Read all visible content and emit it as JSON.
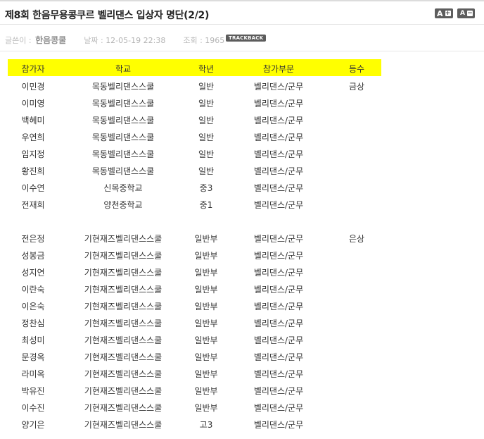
{
  "post": {
    "title": "제8회 한음무용콩쿠르 벨리댄스 입상자 명단(2/2)",
    "font_controls": {
      "increase_label": "A",
      "increase_sign": "+",
      "decrease_label": "A",
      "decrease_sign": "−"
    },
    "meta": {
      "author_label": "글쓴이 :",
      "author": "한음콩쿨",
      "date_label": "날짜 :",
      "date": "12-05-19 22:38",
      "views_label": "조회 :",
      "views": "1965",
      "trackback_label": "TRACKBACK"
    }
  },
  "table": {
    "headers": [
      "참가자",
      "학교",
      "학년",
      "참가부문",
      "등수"
    ],
    "group1": [
      [
        "이민경",
        "목동벨리댄스스쿨",
        "일반",
        "벨리댄스/군무",
        "금상"
      ],
      [
        "이미영",
        "목동벨리댄스스쿨",
        "일반",
        "벨리댄스/군무",
        ""
      ],
      [
        "백혜미",
        "목동벨리댄스스쿨",
        "일반",
        "벨리댄스/군무",
        ""
      ],
      [
        "우연희",
        "목동벨리댄스스쿨",
        "일반",
        "벨리댄스/군무",
        ""
      ],
      [
        "임지정",
        "목동벨리댄스스쿨",
        "일반",
        "벨리댄스/군무",
        ""
      ],
      [
        "황진희",
        "목동벨리댄스스쿨",
        "일반",
        "벨리댄스/군무",
        ""
      ],
      [
        "이수연",
        "신목중학교",
        "중3",
        "벨리댄스/군무",
        ""
      ],
      [
        "전재희",
        "양천중학교",
        "중1",
        "벨리댄스/군무",
        ""
      ]
    ],
    "group2": [
      [
        "전은정",
        "기현재즈벨리댄스스쿨",
        "일반부",
        "벨리댄스/군무",
        "은상"
      ],
      [
        "성봉금",
        "기현재즈벨리댄스스쿨",
        "일반부",
        "벨리댄스/군무",
        ""
      ],
      [
        "성지연",
        "기현재즈벨리댄스스쿨",
        "일반부",
        "벨리댄스/군무",
        ""
      ],
      [
        "이란숙",
        "기현재즈벨리댄스스쿨",
        "일반부",
        "벨리댄스/군무",
        ""
      ],
      [
        "이은숙",
        "기현재즈벨리댄스스쿨",
        "일반부",
        "벨리댄스/군무",
        ""
      ],
      [
        "정찬심",
        "기현재즈벨리댄스스쿨",
        "일반부",
        "벨리댄스/군무",
        ""
      ],
      [
        "최성미",
        "기현재즈벨리댄스스쿨",
        "일반부",
        "벨리댄스/군무",
        ""
      ],
      [
        "문경옥",
        "기현재즈벨리댄스스쿨",
        "일반부",
        "벨리댄스/군무",
        ""
      ],
      [
        "라미옥",
        "기현재즈벨리댄스스쿨",
        "일반부",
        "벨리댄스/군무",
        ""
      ],
      [
        "박유진",
        "기현재즈벨리댄스스쿨",
        "일반부",
        "벨리댄스/군무",
        ""
      ],
      [
        "이수진",
        "기현재즈벨리댄스스쿨",
        "일반부",
        "벨리댄스/군무",
        ""
      ],
      [
        "양기은",
        "기현재즈벨리댄스스쿨",
        "고3",
        "벨리댄스/군무",
        ""
      ]
    ]
  },
  "colors": {
    "header_bar": "#ffff00",
    "text": "#333333"
  }
}
